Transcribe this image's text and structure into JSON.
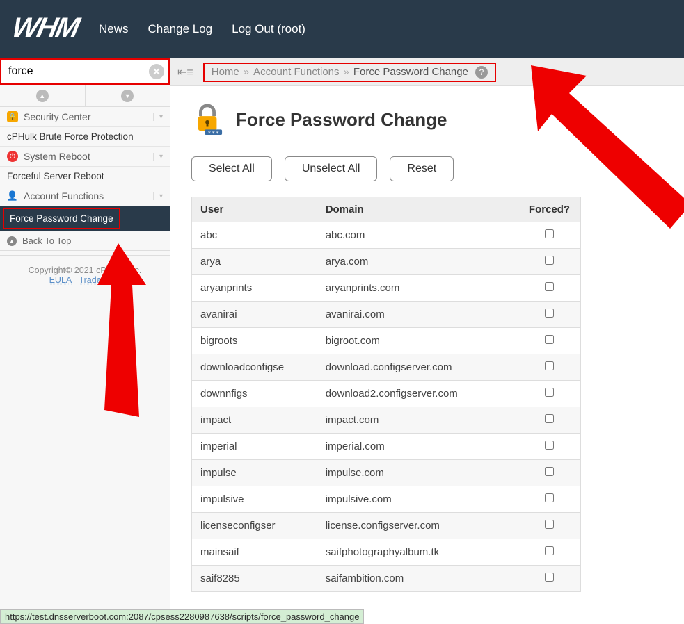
{
  "header": {
    "logo": "WHM",
    "nav": [
      "News",
      "Change Log",
      "Log Out (root)"
    ]
  },
  "search": {
    "value": "force"
  },
  "sidebar": {
    "cats": [
      {
        "icon": "shield",
        "label": "Security Center"
      },
      {
        "label": "cPHulk Brute Force Protection",
        "plain": true
      },
      {
        "icon": "power",
        "label": "System Reboot"
      },
      {
        "label": "Forceful Server Reboot",
        "plain": true
      },
      {
        "icon": "user",
        "label": "Account Functions"
      }
    ],
    "active": "Force Password Change",
    "back": "Back To Top",
    "footer": {
      "copyright": "Copyright© 2021 cPanel, Inc.",
      "links": [
        "EULA",
        "Trademark"
      ]
    }
  },
  "breadcrumb": {
    "home": "Home",
    "section": "Account Functions",
    "current": "Force Password Change"
  },
  "page": {
    "title": "Force Password Change",
    "buttons": {
      "select_all": "Select All",
      "unselect_all": "Unselect All",
      "reset": "Reset"
    },
    "columns": {
      "user": "User",
      "domain": "Domain",
      "forced": "Forced?"
    },
    "rows": [
      {
        "user": "abc",
        "domain": "abc.com"
      },
      {
        "user": "arya",
        "domain": "arya.com"
      },
      {
        "user": "aryanprints",
        "domain": "aryanprints.com"
      },
      {
        "user": "avanirai",
        "domain": "avanirai.com"
      },
      {
        "user": "bigroots",
        "domain": "bigroot.com"
      },
      {
        "user": "downloadconfigse",
        "domain": "download.configserver.com"
      },
      {
        "user": "downnfigs",
        "domain": "download2.configserver.com"
      },
      {
        "user": "impact",
        "domain": "impact.com"
      },
      {
        "user": "imperial",
        "domain": "imperial.com"
      },
      {
        "user": "impulse",
        "domain": "impulse.com"
      },
      {
        "user": "impulsive",
        "domain": "impulsive.com"
      },
      {
        "user": "licenseconfigser",
        "domain": "license.configserver.com"
      },
      {
        "user": "mainsaif",
        "domain": "saifphotographyalbum.tk"
      },
      {
        "user": "saif8285",
        "domain": "saifambition.com"
      }
    ]
  },
  "status_url": "https://test.dnsserverboot.com:2087/cpsess2280987638/scripts/force_password_change"
}
